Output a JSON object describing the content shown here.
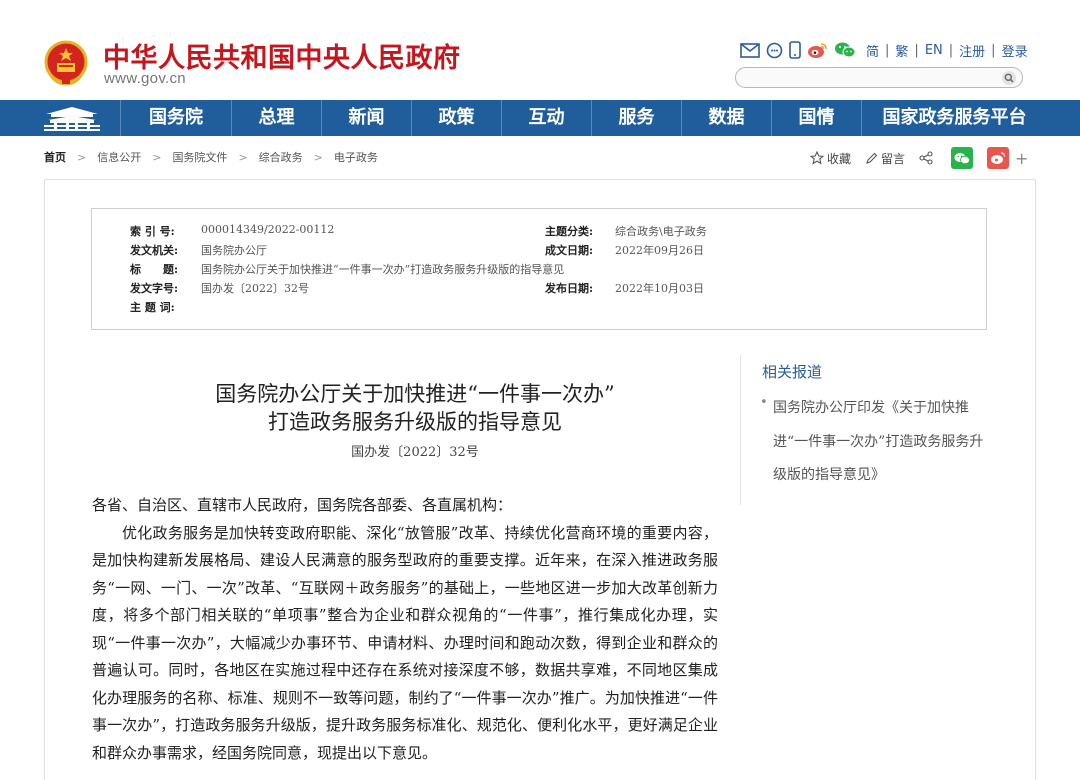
{
  "header": {
    "site_title": "中华人民共和国中央人民政府",
    "site_domain": "www.gov.cn",
    "share_icons": [
      "mail-icon",
      "chat-bubble-icon",
      "mobile-icon",
      "weibo-icon",
      "wechat-icon"
    ],
    "lang_links": [
      "简",
      "繁",
      "EN",
      "注册",
      "登录"
    ],
    "search": {
      "placeholder": ""
    }
  },
  "nav": {
    "items": [
      "国务院",
      "总理",
      "新闻",
      "政策",
      "互动",
      "服务",
      "数据",
      "国情",
      "国家政务服务平台"
    ]
  },
  "breadcrumb": [
    "首页",
    "信息公开",
    "国务院文件",
    "综合政务",
    "电子政务"
  ],
  "tools": {
    "favorite": "收藏",
    "comment": "留言"
  },
  "meta": {
    "index_label": "索 引 号:",
    "index_value": "000014349/2022-00112",
    "topic_label": "主题分类:",
    "topic_value": "综合政务\\电子政务",
    "issuer_label": "发文机关:",
    "issuer_value": "国务院办公厅",
    "written_label": "成文日期:",
    "written_value": "2022年09月26日",
    "title_label": "标　　题:",
    "title_value": "国务院办公厅关于加快推进“一件事一次办”打造政务服务升级版的指导意见",
    "docno_label": "发文字号:",
    "docno_value": "国办发〔2022〕32号",
    "published_label": "发布日期:",
    "published_value": "2022年10月03日",
    "keywords_label": "主 题 词:"
  },
  "article": {
    "title_line1": "国务院办公厅关于加快推进“一件事一次办”",
    "title_line2": "打造政务服务升级版的指导意见",
    "doc_number": "国办发〔2022〕32号",
    "salutation": "各省、自治区、直辖市人民政府，国务院各部委、各直属机构：",
    "paragraph1": "优化政务服务是加快转变政府职能、深化“放管服”改革、持续优化营商环境的重要内容，是加快构建新发展格局、建设人民满意的服务型政府的重要支撑。近年来，在深入推进政务服务“一网、一门、一次”改革、“互联网＋政务服务”的基础上，一些地区进一步加大改革创新力度，将多个部门相关联的“单项事”整合为企业和群众视角的“一件事”，推行集成化办理，实现“一件事一次办”，大幅减少办事环节、申请材料、办理时间和跑动次数，得到企业和群众的普遍认可。同时，各地区在实施过程中还存在系统对接深度不够，数据共享难，不同地区集成化办理服务的名称、标准、规则不一致等问题，制约了“一件事一次办”推广。为加快推进“一件事一次办”，打造政务服务升级版，提升政务服务标准化、规范化、便利化水平，更好满足企业和群众办事需求，经国务院同意，现提出以下意见。"
  },
  "sidebar": {
    "title": "相关报道",
    "links": [
      "国务院办公厅印发《关于加快推进“一件事一次办”打造政务服务升级版的指导意见》"
    ]
  },
  "colors": {
    "brand_red": "#c4161c",
    "nav_blue": "#1f5d9b",
    "link_blue": "#2a5d9b",
    "wechat_green": "#2ab24b",
    "weibo_orange": "#e8574e"
  }
}
